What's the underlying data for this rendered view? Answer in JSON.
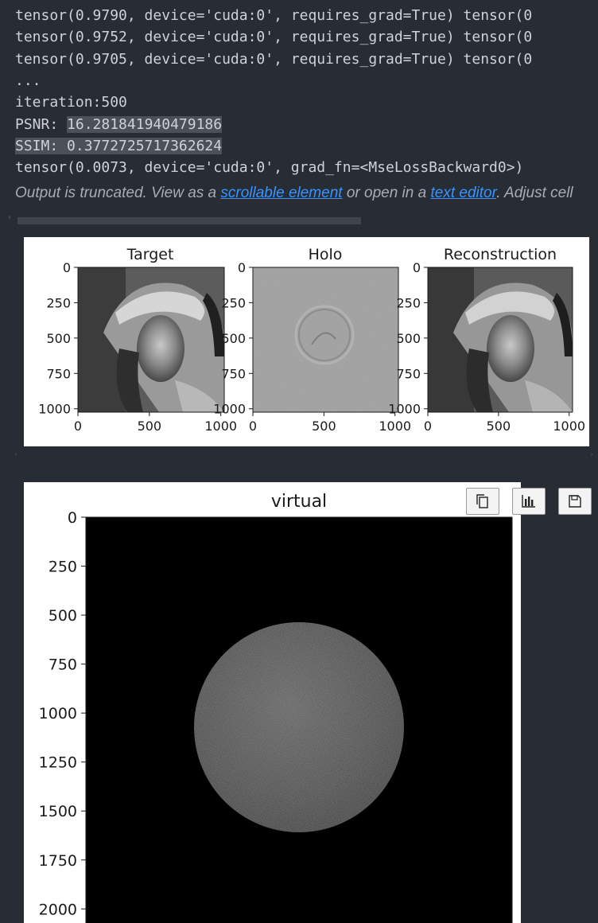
{
  "output": {
    "lines": [
      "tensor(0.9790, device='cuda:0', requires_grad=True) tensor(0",
      "tensor(0.9752, device='cuda:0', requires_grad=True) tensor(0",
      "tensor(0.9705, device='cuda:0', requires_grad=True) tensor(0",
      "...",
      "iteration:500"
    ],
    "psnr_label": "PSNR: ",
    "psnr_value": "16.281841940479186",
    "ssim_line": "SSIM: 0.3772725717362624",
    "loss_line": "tensor(0.0073, device='cuda:0', grad_fn=<MseLossBackward0>)",
    "truncated": {
      "prefix": "Output is truncated. View as a ",
      "link1": "scrollable element",
      "middle": " or open in a ",
      "link2": "text editor",
      "suffix": ". Adjust cell"
    }
  },
  "figure1": {
    "panels": [
      {
        "title": "Target",
        "image": "lena-grayscale"
      },
      {
        "title": "Holo",
        "image": "hologram-phase-pattern"
      },
      {
        "title": "Reconstruction",
        "image": "lena-grayscale-reconstruction"
      }
    ],
    "x_ticks": [
      "0",
      "500",
      "1000"
    ],
    "y_ticks": [
      "0",
      "250",
      "500",
      "750",
      "1000"
    ]
  },
  "figure2": {
    "title": "virtual",
    "image": "black-field-with-noisy-gray-disk",
    "y_ticks": [
      "0",
      "250",
      "500",
      "750",
      "1000",
      "1250",
      "1500",
      "1750",
      "2000"
    ]
  },
  "toolbar": {
    "copy_icon": "copy-icon",
    "chart_icon": "bar-chart-icon",
    "save_icon": "save-icon"
  }
}
